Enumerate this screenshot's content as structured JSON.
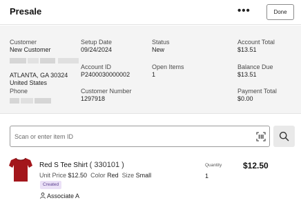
{
  "header": {
    "title": "Presale",
    "more_label": "•••",
    "done_label": "Done"
  },
  "summary": {
    "customer_label": "Customer",
    "customer_name": "New Customer",
    "customer_city": "ATLANTA, GA 30324",
    "customer_country": "United States",
    "phone_label": "Phone",
    "setup_date_label": "Setup Date",
    "setup_date": "09/24/2024",
    "account_id_label": "Account ID",
    "account_id": "P2400030000002",
    "customer_number_label": "Customer Number",
    "customer_number": "1297918",
    "status_label": "Status",
    "status": "New",
    "open_items_label": "Open Items",
    "open_items": "1",
    "account_total_label": "Account Total",
    "account_total": "$13.51",
    "balance_due_label": "Balance Due",
    "balance_due": "$13.51",
    "payment_total_label": "Payment Total",
    "payment_total": "$0.00"
  },
  "search": {
    "placeholder": "Scan or enter item ID",
    "value": ""
  },
  "item": {
    "name": "Red S Tee Shirt",
    "sku": "( 330101 )",
    "unit_price_label": "Unit Price",
    "unit_price": "$12.50",
    "color_label": "Color",
    "color": "Red",
    "size_label": "Size",
    "size": "Small",
    "badge": "Created",
    "associate": "Associate A",
    "quantity_label": "Quantity",
    "quantity": "1",
    "price": "$12.50",
    "shirt_color": "#a3161b"
  },
  "icons": {
    "scan": "barcode-scan-icon",
    "search": "search-icon",
    "person": "person-icon",
    "product": "tee-shirt-icon"
  },
  "colors": {
    "summary_bg": "#f4f4f4",
    "badge_bg": "#ebe1f7",
    "badge_text": "#5b3f8f"
  }
}
